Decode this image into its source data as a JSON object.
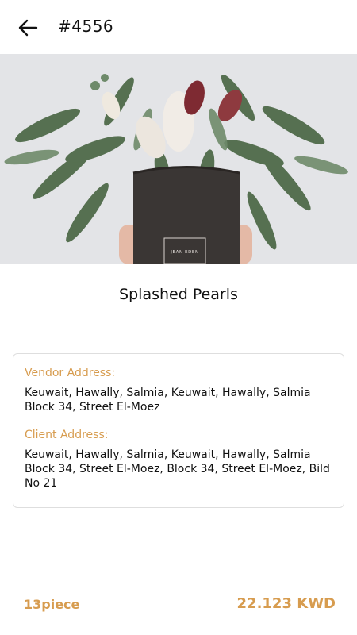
{
  "header": {
    "back_icon": "arrow-left-icon",
    "order_number": "#4556"
  },
  "hero": {
    "box_brand": "JEAN EDEN"
  },
  "product": {
    "name": "Splashed Pearls"
  },
  "addresses": {
    "vendor_label": "Vendor Address:",
    "vendor_value": "Keuwait, Hawally, Salmia, Keuwait, Hawally, Salmia Block 34, Street El-Moez",
    "client_label": "Client Address:",
    "client_value": "Keuwait, Hawally, Salmia, Keuwait, Hawally, Salmia Block 34, Street El-Moez, Block 34, Street El-Moez, Bild No 21"
  },
  "footer": {
    "quantity": "13piece",
    "total": "22.123 KWD"
  },
  "colors": {
    "accent": "#d79c4f",
    "text": "#111111",
    "card_border": "#dedede",
    "background": "#ffffff"
  }
}
